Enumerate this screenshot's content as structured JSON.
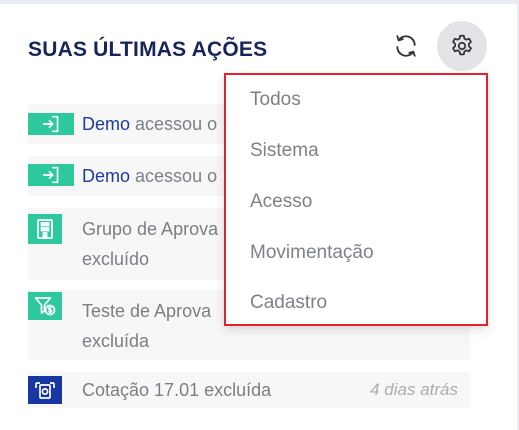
{
  "header": {
    "title": "SUAS ÚLTIMAS AÇÕES"
  },
  "feed": {
    "items": [
      {
        "icon": "login-icon",
        "who": "Demo",
        "text": "acessou o"
      },
      {
        "icon": "login-icon",
        "who": "Demo",
        "text": "acessou o"
      },
      {
        "icon": "building-icon",
        "line1": "Grupo de Aprova",
        "line2": "excluído"
      },
      {
        "icon": "funnel-money-icon",
        "line1": "Teste de Aprova",
        "line2": "excluída"
      },
      {
        "icon": "quote-document-icon",
        "text": "Cotação 17.01 excluída",
        "time": "4 dias atrás"
      }
    ]
  },
  "filter_menu": {
    "options": [
      "Todos",
      "Sistema",
      "Acesso",
      "Movimentação",
      "Cadastro"
    ]
  },
  "colors": {
    "title": "#17255c",
    "accent_green": "#2dc99d",
    "accent_blue": "#1738a3",
    "highlight_border": "#e3232c"
  }
}
